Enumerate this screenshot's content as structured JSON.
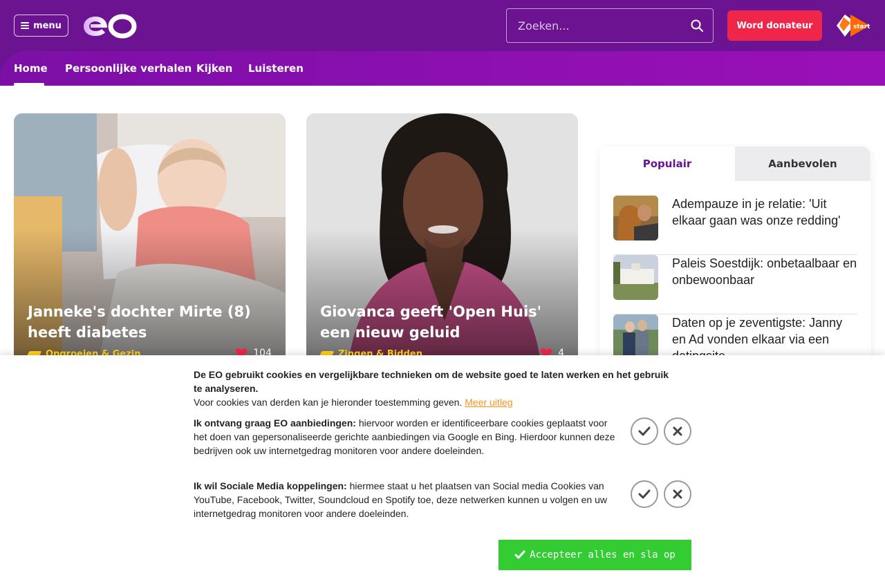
{
  "header": {
    "menu_label": "menu",
    "search_placeholder": "Zoeken...",
    "donate_label": "Word donateur",
    "npo_label": "start"
  },
  "nav": {
    "items": [
      {
        "label": "Home"
      },
      {
        "label": "Persoonlijke verhalen"
      },
      {
        "label": "Kijken"
      },
      {
        "label": "Luisteren"
      }
    ]
  },
  "cards": [
    {
      "title": "Janneke's dochter Mirte (8) heeft diabetes",
      "category": "Opgroeien & Gezin",
      "likes": "104"
    },
    {
      "title": "Giovanca geeft 'Open Huis' een nieuw geluid",
      "category": "Zingen & Bidden",
      "likes": "4"
    }
  ],
  "sidebar": {
    "tabs": [
      {
        "label": "Populair"
      },
      {
        "label": "Aanbevolen"
      }
    ],
    "items": [
      {
        "title": "Adempauze in je relatie: 'Uit elkaar gaan was onze redding'"
      },
      {
        "title": "Paleis Soestdijk: onbetaalbaar en onbewoonbaar"
      },
      {
        "title": "Daten op je zeventigste: Janny en Ad vonden elkaar via een datingsite"
      }
    ]
  },
  "cookie": {
    "intro_bold": "De EO gebruikt cookies en vergelijkbare technieken om de website goed te laten werken en het gebruik te analyseren.",
    "intro_text": "Voor cookies van derden kan je hieronder toestemming geven.",
    "more_link": "Meer uitleg",
    "offers_bold": "Ik ontvang graag EO aanbiedingen:",
    "offers_text": " hiervoor worden er identificeerbare cookies geplaatst voor het doen van gepersonaliseerde gerichte aanbiedingen via Google en Bing. Hierdoor kunnen deze bedrijven ook uw internetgedrag monitoren voor andere doeleinden.",
    "social_bold": "Ik wil Sociale Media koppelingen:",
    "social_text": " hiermee staat u het plaatsen van Social media Cookies van YouTube, Facebook, Twitter, Soundcloud en Spotify toe, deze netwerken kunnen u volgen en uw internetgedrag monitoren voor andere doeleinden.",
    "accept_label": "Accepteer alles en sla op"
  },
  "colors": {
    "header_purple": "#6b1390",
    "donate_red": "#f0254a",
    "accept_green": "#33cc33",
    "category_yellow": "#ffd11a",
    "link_orange": "#ff8f1f"
  },
  "icons": [
    "menu-icon",
    "search-icon",
    "heart-icon",
    "category-tag-icon",
    "check-icon",
    "close-icon"
  ]
}
